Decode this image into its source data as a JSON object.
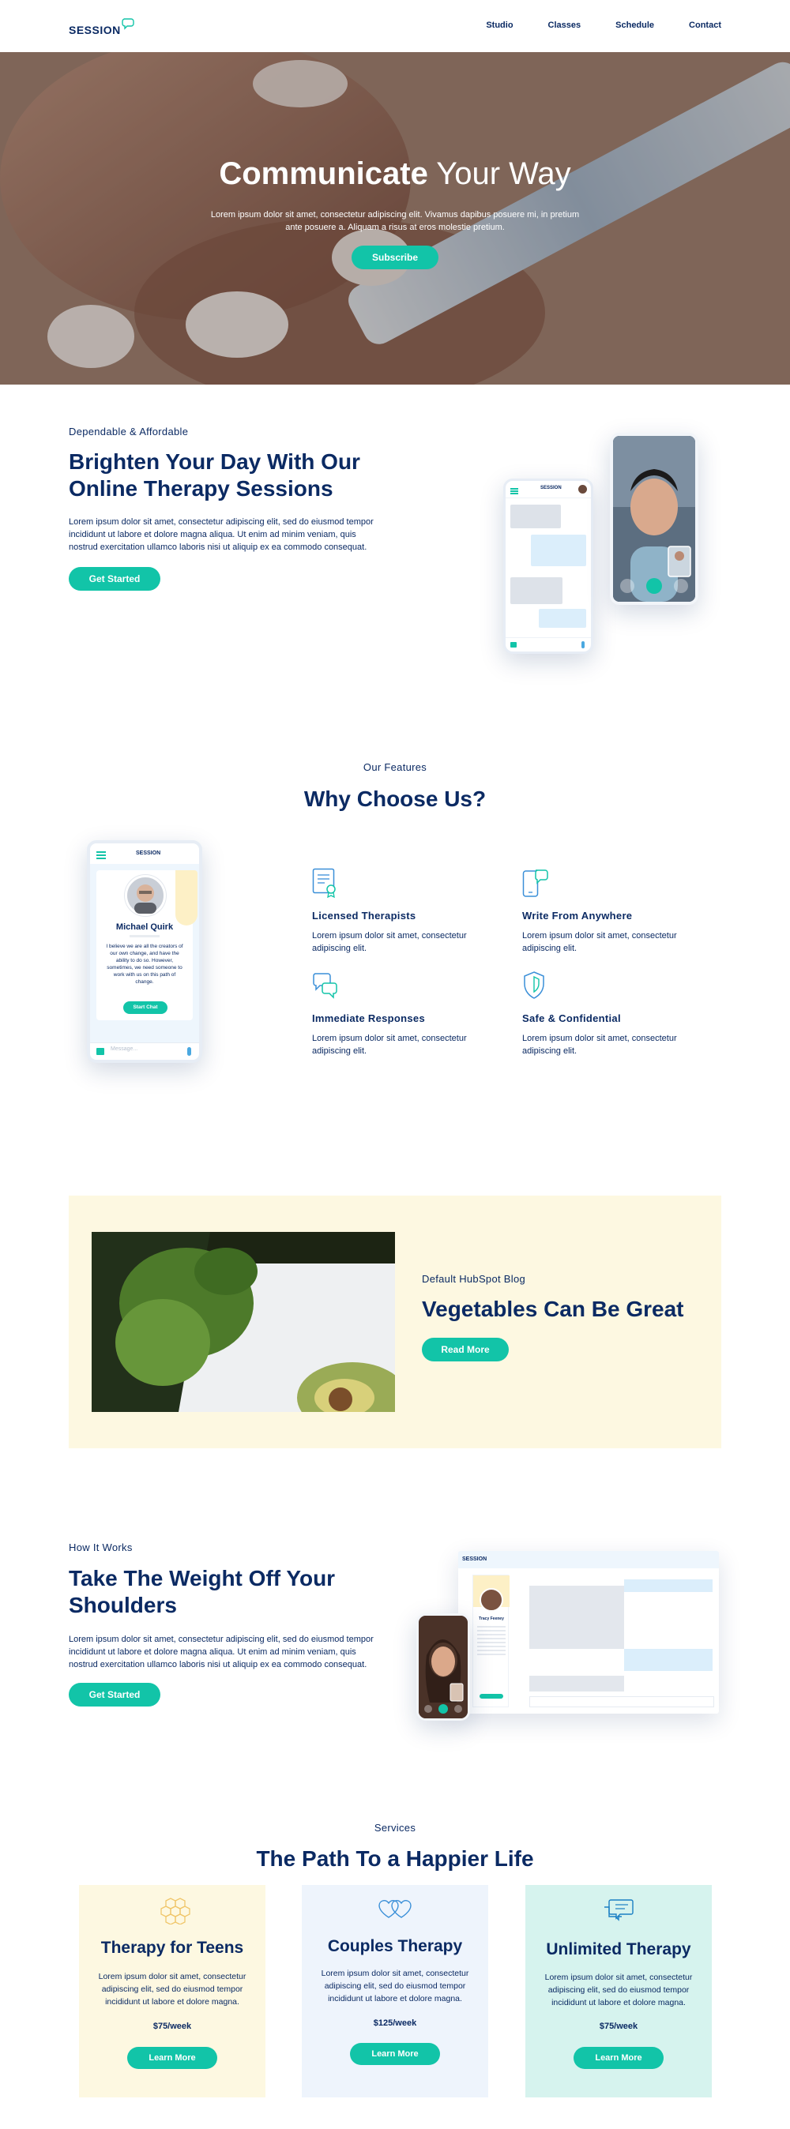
{
  "header": {
    "logo": "SESSION",
    "nav": [
      "Studio",
      "Classes",
      "Schedule",
      "Contact"
    ]
  },
  "hero": {
    "title_bold": "Communicate",
    "title_light": " Your Way",
    "text": "Lorem ipsum dolor sit amet, consectetur adipiscing elit. Vivamus dapibus posuere mi, in pretium ante posuere a. Aliquam a risus at eros molestie pretium.",
    "button": "Subscribe"
  },
  "about": {
    "eyebrow": "Dependable & Affordable",
    "title": "Brighten Your Day With Our Online Therapy Sessions",
    "text": "Lorem ipsum dolor sit amet, consectetur adipiscing elit, sed do eiusmod tempor incididunt ut labore et dolore magna aliqua. Ut enim ad minim veniam, quis nostrud exercitation ullamco laboris nisi ut aliquip ex ea commodo consequat.",
    "button": "Get Started",
    "phone_logo": "SESSION"
  },
  "features": {
    "eyebrow": "Our Features",
    "title": "Why Choose Us?",
    "profile": {
      "logo": "SESSION",
      "name": "Michael Quirk",
      "bio": "I believe we are all the creators of our own change, and have the ability to do so. However, sometimes, we need someone to work with us on this path of change.",
      "button": "Start Chat",
      "input_placeholder": "Message..."
    },
    "items": [
      {
        "title": "Licensed Therapists",
        "text": "Lorem ipsum dolor sit amet, consectetur adipiscing elit.",
        "icon": "certificate-icon"
      },
      {
        "title": "Write From Anywhere",
        "text": "Lorem ipsum dolor sit amet, consectetur adipiscing elit.",
        "icon": "mobile-chat-icon"
      },
      {
        "title": "Immediate Responses",
        "text": "Lorem ipsum dolor sit amet, consectetur adipiscing elit.",
        "icon": "chat-bubbles-icon"
      },
      {
        "title": "Safe & Confidential",
        "text": "Lorem ipsum dolor sit amet, consectetur adipiscing elit.",
        "icon": "shield-icon"
      }
    ]
  },
  "blog": {
    "eyebrow": "Default HubSpot Blog",
    "title": "Vegetables Can Be Great",
    "button": "Read More"
  },
  "how": {
    "eyebrow": "How It Works",
    "title": "Take The Weight Off Your Shoulders",
    "text": "Lorem ipsum dolor sit amet, consectetur adipiscing elit, sed do eiusmod tempor incididunt ut labore et dolore magna aliqua. Ut enim ad minim veniam, quis nostrud exercitation ullamco laboris nisi ut aliquip ex ea commodo consequat.",
    "button": "Get Started",
    "desktop_logo": "SESSION",
    "contact_name": "Tracy Feeney"
  },
  "services": {
    "eyebrow": "Services",
    "title": "The Path To a Happier Life",
    "cards": [
      {
        "title": "Therapy for Teens",
        "text": "Lorem ipsum dolor sit amet, consectetur adipiscing elit, sed do eiusmod tempor incididunt ut labore et dolore magna.",
        "price": "$75/week",
        "button": "Learn More",
        "bg": "#fdf8e1",
        "icon": "hexagons-icon"
      },
      {
        "title": "Couples Therapy",
        "text": "Lorem ipsum dolor sit amet, consectetur adipiscing elit, sed do eiusmod tempor incididunt ut labore et dolore magna.",
        "price": "$125/week",
        "button": "Learn More",
        "bg": "#eef4fc",
        "icon": "hearts-icon"
      },
      {
        "title": "Unlimited Therapy",
        "text": "Lorem ipsum dolor sit amet, consectetur adipiscing elit, sed do eiusmod tempor incididunt ut labore et dolore magna.",
        "price": "$75/week",
        "button": "Learn More",
        "bg": "#d6f3ee",
        "icon": "chat-bubbles-icon"
      }
    ]
  },
  "colors": {
    "navy": "#0b2a63",
    "teal": "#12c4a8",
    "cream": "#fdf8e1",
    "light_blue": "#eef4fc",
    "mint": "#d6f3ee"
  }
}
